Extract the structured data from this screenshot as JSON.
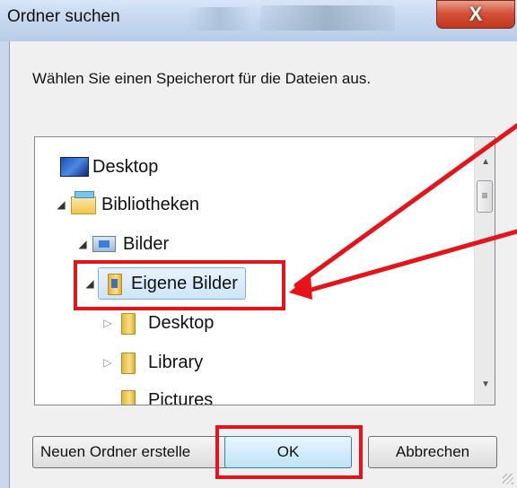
{
  "window": {
    "title": "Ordner suchen",
    "close_label": "X"
  },
  "instruction": "Wählen Sie einen Speicherort für die Dateien aus.",
  "tree": {
    "items": [
      {
        "label": "Desktop",
        "icon": "desktop-icon"
      },
      {
        "label": "Bibliotheken",
        "icon": "libraries-icon",
        "expanded": true
      },
      {
        "label": "Bilder",
        "icon": "pictures-library-icon",
        "expanded": true
      },
      {
        "label": "Eigene Bilder",
        "icon": "folder-pictures-icon",
        "expanded": true,
        "selected": true
      },
      {
        "label": "Desktop",
        "icon": "folder-icon",
        "expanded": false
      },
      {
        "label": "Library",
        "icon": "folder-icon",
        "expanded": false
      },
      {
        "label": "Pictures",
        "icon": "folder-icon"
      }
    ]
  },
  "buttons": {
    "new_folder": "Neuen Ordner erstelle",
    "ok": "OK",
    "cancel": "Abbrechen"
  },
  "annotation_color": "#e5141b"
}
